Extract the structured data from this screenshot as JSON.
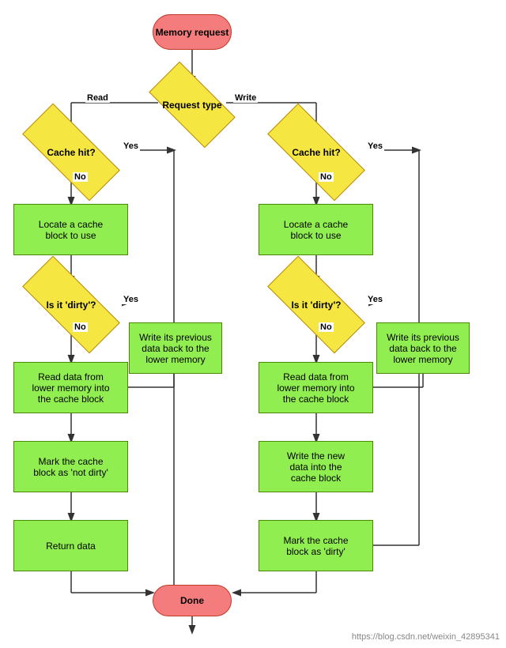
{
  "nodes": {
    "memory_request": "Memory\nrequest",
    "request_type": "Request\ntype",
    "read_label": "Read",
    "write_label": "Write",
    "cache_hit_left": "Cache hit?",
    "cache_hit_right": "Cache hit?",
    "locate_left": "Locate a cache\nblock to use",
    "locate_right": "Locate a cache\nblock to use",
    "dirty_left": "Is it 'dirty'?",
    "dirty_right": "Is it 'dirty'?",
    "write_back_left": "Write its previous\ndata back to the\nlower memory",
    "write_back_right": "Write its previous\ndata back to the\nlower memory",
    "read_mem_left": "Read data from\nlower memory into\nthe cache block",
    "read_mem_right": "Read data from\nlower memory into\nthe cache block",
    "mark_not_dirty": "Mark the cache\nblock as 'not dirty'",
    "write_new_data": "Write the new\ndata into the\ncache block",
    "return_data": "Return data",
    "mark_dirty": "Mark the cache\nblock as 'dirty'",
    "done": "Done",
    "yes": "Yes",
    "no": "No"
  },
  "watermark": "https://blog.csdn.net/weixin_42895341"
}
